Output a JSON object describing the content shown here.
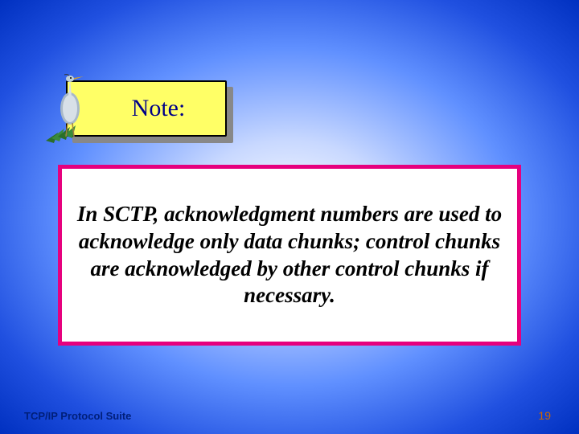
{
  "note": {
    "label": "Note:"
  },
  "icon": {
    "name": "heron-bird-icon"
  },
  "content": {
    "text": "In SCTP, acknowledgment numbers are used to acknowledge only data chunks; control chunks are acknowledged by other control chunks if necessary."
  },
  "footer": {
    "left": "TCP/IP Protocol Suite",
    "page": "19"
  },
  "colors": {
    "note_bg": "#ffff66",
    "content_border": "#e6007e",
    "footer_text": "#001f7a",
    "page_num": "#cc6600"
  }
}
